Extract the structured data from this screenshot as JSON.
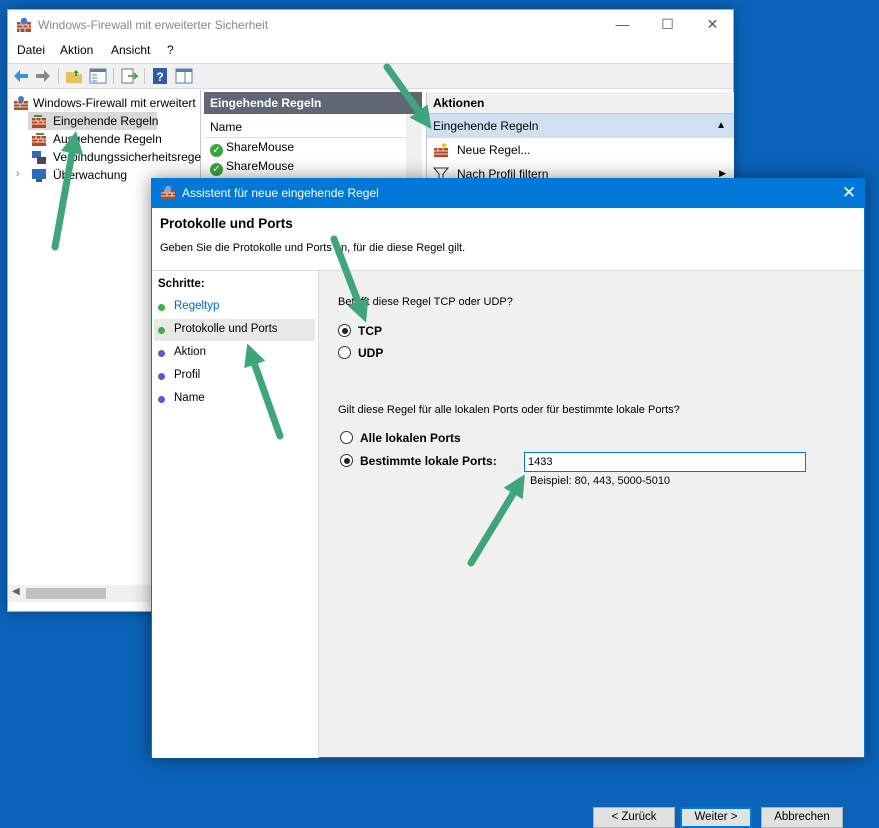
{
  "mmc": {
    "title": "Windows-Firewall mit erweiterter Sicherheit",
    "menu": [
      "Datei",
      "Aktion",
      "Ansicht",
      "?"
    ],
    "tree": [
      {
        "label": "Windows-Firewall mit erweitert",
        "icon": "firewall-icon"
      },
      {
        "label": "Eingehende Regeln",
        "icon": "inbound-rules-icon"
      },
      {
        "label": "Ausgehende Regeln",
        "icon": "outbound-rules-icon"
      },
      {
        "label": "Verbindungssicherheitsrege",
        "icon": "connection-security-icon"
      },
      {
        "label": "Überwachung",
        "icon": "monitoring-icon"
      }
    ],
    "middle": {
      "header": "Eingehende Regeln",
      "column": "Name",
      "rows": [
        "ShareMouse",
        "ShareMouse"
      ]
    },
    "actions": {
      "header": "Aktionen",
      "section": "Eingehende Regeln",
      "items": [
        "Neue Regel...",
        "Nach Profil filtern"
      ]
    }
  },
  "wizard": {
    "title": "Assistent für neue eingehende Regel",
    "header_title": "Protokolle und Ports",
    "header_subtitle": "Geben Sie die Protokolle und Ports an, für die diese Regel gilt.",
    "steps_title": "Schritte:",
    "steps": [
      {
        "label": "Regeltyp",
        "state": "done",
        "color": "#3cb043"
      },
      {
        "label": "Protokolle und Ports",
        "state": "current",
        "color": "#3cb043"
      },
      {
        "label": "Aktion",
        "state": "pending",
        "color": "#5a5ad0"
      },
      {
        "label": "Profil",
        "state": "pending",
        "color": "#5a5ad0"
      },
      {
        "label": "Name",
        "state": "pending",
        "color": "#5a5ad0"
      }
    ],
    "protocol_question": "Betrifft diese Regel TCP oder UDP?",
    "protocol_options": [
      {
        "label": "TCP",
        "selected": true
      },
      {
        "label": "UDP",
        "selected": false
      }
    ],
    "ports_question": "Gilt diese Regel für alle lokalen Ports oder für bestimmte lokale Ports?",
    "ports_options": [
      {
        "label": "Alle lokalen Ports",
        "selected": false
      },
      {
        "label": "Bestimmte lokale Ports:",
        "selected": true
      }
    ],
    "ports_value": "1433",
    "ports_example": "Beispiel: 80, 443, 5000-5010",
    "buttons": {
      "back": "< Zurück",
      "next": "Weiter >",
      "cancel": "Abbrechen"
    }
  },
  "colors": {
    "desktop": "#0a63b8",
    "accent": "#0078d7",
    "arrow": "#3fa57a"
  }
}
